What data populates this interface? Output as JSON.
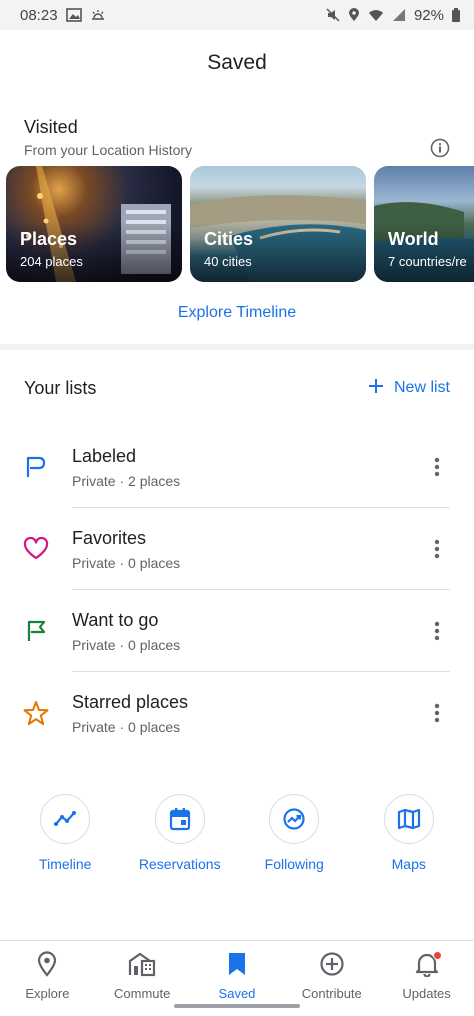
{
  "status_bar": {
    "time": "08:23",
    "battery": "92%"
  },
  "header": {
    "title": "Saved"
  },
  "visited": {
    "title": "Visited",
    "subtitle": "From your Location History",
    "cards": [
      {
        "title": "Places",
        "subtitle": "204 places"
      },
      {
        "title": "Cities",
        "subtitle": "40 cities"
      },
      {
        "title": "World",
        "subtitle": "7 countries/re"
      }
    ],
    "explore_link": "Explore Timeline"
  },
  "lists": {
    "title": "Your lists",
    "new_list_label": "New list",
    "items": [
      {
        "name": "Labeled",
        "meta": "Private · 2 places",
        "icon": "flag-outline-icon",
        "color": "#1a73e8"
      },
      {
        "name": "Favorites",
        "meta": "Private · 0 places",
        "icon": "heart-icon",
        "color": "#d01884"
      },
      {
        "name": "Want to go",
        "meta": "Private · 0 places",
        "icon": "flag-icon",
        "color": "#188038"
      },
      {
        "name": "Starred places",
        "meta": "Private · 0 places",
        "icon": "star-icon",
        "color": "#e37400"
      }
    ]
  },
  "shortcuts": [
    {
      "label": "Timeline",
      "icon": "timeline-icon"
    },
    {
      "label": "Reservations",
      "icon": "calendar-icon"
    },
    {
      "label": "Following",
      "icon": "trending-icon"
    },
    {
      "label": "Maps",
      "icon": "map-icon"
    }
  ],
  "bottom_nav": [
    {
      "label": "Explore",
      "icon": "location-pin-icon"
    },
    {
      "label": "Commute",
      "icon": "commute-icon"
    },
    {
      "label": "Saved",
      "icon": "bookmark-icon",
      "active": true
    },
    {
      "label": "Contribute",
      "icon": "add-circle-icon"
    },
    {
      "label": "Updates",
      "icon": "bell-icon"
    }
  ],
  "colors": {
    "accent": "#1a73e8",
    "text": "#202124",
    "secondary_text": "#5f6368"
  }
}
